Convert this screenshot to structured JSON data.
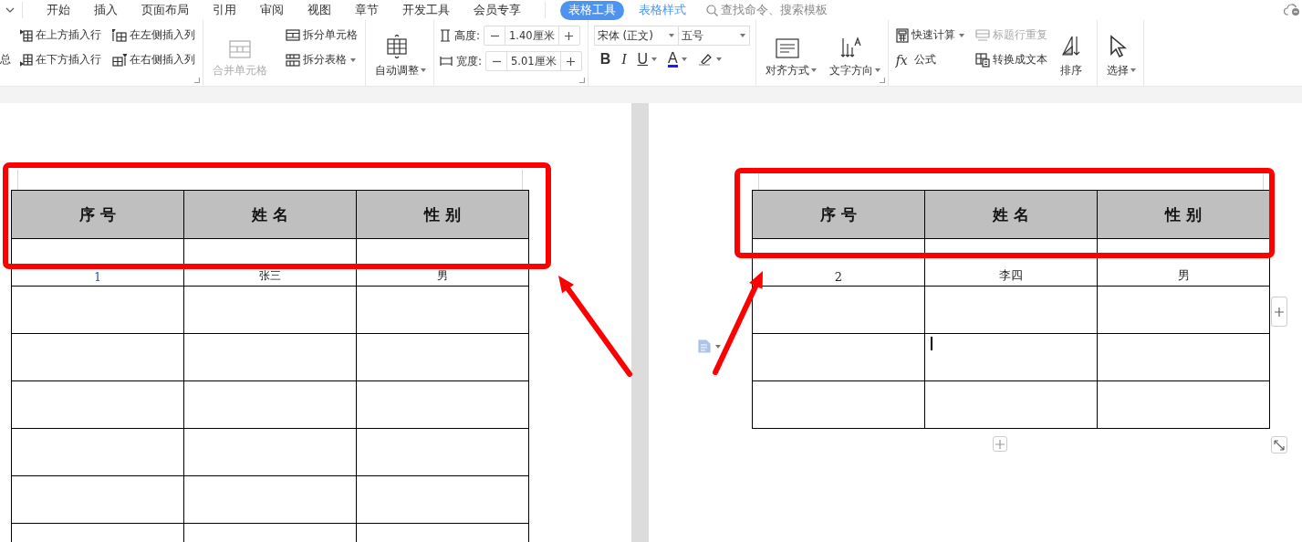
{
  "menu_tabs": [
    {
      "label": "开始",
      "selected": false
    },
    {
      "label": "插入",
      "selected": false
    },
    {
      "label": "页面布局",
      "selected": false
    },
    {
      "label": "引用",
      "selected": false
    },
    {
      "label": "审阅",
      "selected": false
    },
    {
      "label": "视图",
      "selected": false
    },
    {
      "label": "章节",
      "selected": false
    },
    {
      "label": "开发工具",
      "selected": false
    },
    {
      "label": "会员专享",
      "selected": false
    },
    {
      "label": "表格工具",
      "selected": true
    },
    {
      "label": "表格样式",
      "selected": false
    }
  ],
  "search": {
    "placeholder": "查找命令、搜索模板"
  },
  "ribbon": [
    {
      "launcher": true,
      "columns": [
        [
          {
            "kind": "text",
            "label": "总"
          }
        ],
        [
          {
            "kind": "small",
            "label": "在上方插入行",
            "disabled": false,
            "dropdown": false
          },
          {
            "kind": "small",
            "label": "在下方插入行",
            "disabled": false,
            "dropdown": false
          }
        ],
        [
          {
            "kind": "small",
            "label": "在左侧插入列",
            "disabled": false,
            "dropdown": false
          },
          {
            "kind": "small",
            "label": "在右侧插入列",
            "disabled": false,
            "dropdown": false
          }
        ]
      ]
    },
    {
      "columns": [
        [
          {
            "kind": "big",
            "label": "合并单元格",
            "disabled": true,
            "dropdown": false
          }
        ],
        [
          {
            "kind": "small",
            "label": "拆分单元格",
            "disabled": false,
            "dropdown": false
          },
          {
            "kind": "small",
            "label": "拆分表格",
            "disabled": false,
            "dropdown": true
          }
        ]
      ]
    },
    {
      "columns": [
        [
          {
            "kind": "big",
            "label": "自动调整",
            "disabled": false,
            "dropdown": true
          }
        ]
      ]
    },
    {
      "launcher": true,
      "columns": [
        [
          {
            "kind": "stepper",
            "label": "高度:",
            "value": "1.40厘米"
          },
          {
            "kind": "stepper",
            "label": "宽度:",
            "value": "5.01厘米"
          }
        ]
      ]
    },
    {
      "columns": [
        [
          {
            "kind": "fonts",
            "selects": [
              "宋体 (正文)",
              "五号"
            ]
          },
          {
            "kind": "format",
            "buttons": [
              {
                "label": "B",
                "dropdown": false
              },
              {
                "label": "I",
                "dropdown": false
              },
              {
                "label": "U",
                "dropdown": true
              },
              {
                "label": "A",
                "dropdown": true
              }
            ]
          }
        ]
      ]
    },
    {
      "launcher": true,
      "columns": [
        [
          {
            "kind": "big",
            "label": "对齐方式",
            "disabled": false,
            "dropdown": true
          }
        ],
        [
          {
            "kind": "big",
            "label": "文字方向",
            "disabled": false,
            "dropdown": true
          }
        ]
      ]
    },
    {
      "columns": [
        [
          {
            "kind": "small",
            "label": "快速计算",
            "disabled": false,
            "dropdown": true
          },
          {
            "kind": "glyph",
            "glyph": "fx",
            "label": "公式"
          }
        ],
        [
          {
            "kind": "small",
            "label": "标题行重复",
            "disabled": true,
            "dropdown": false
          },
          {
            "kind": "small",
            "label": "转换成文本",
            "disabled": false,
            "dropdown": false
          }
        ],
        [
          {
            "kind": "big",
            "label": "排序",
            "disabled": false,
            "dropdown": false
          }
        ]
      ]
    },
    {
      "columns": [
        [
          {
            "kind": "big",
            "label": "选择",
            "disabled": false,
            "dropdown": true
          }
        ]
      ]
    }
  ],
  "pages": [
    {
      "table": {
        "header": [
          "序 号",
          "姓 名",
          "性 别"
        ],
        "rows": [
          {
            "cells": [
              {
                "text": "1",
                "caret": false
              },
              {
                "text": "张三",
                "caret": false
              },
              {
                "text": "男",
                "caret": false
              }
            ]
          },
          {
            "cells": [
              {
                "caret": false
              },
              {
                "caret": false
              },
              {
                "caret": false
              }
            ]
          },
          {
            "cells": [
              {
                "caret": false
              },
              {
                "caret": false
              },
              {
                "caret": false
              }
            ]
          },
          {
            "cells": [
              {
                "caret": false
              },
              {
                "caret": false
              },
              {
                "caret": false
              }
            ]
          },
          {
            "cells": [
              {
                "caret": false
              },
              {
                "caret": false
              },
              {
                "caret": false
              }
            ]
          },
          {
            "cells": [
              {
                "caret": false
              },
              {
                "caret": false
              },
              {
                "caret": false
              }
            ]
          },
          {
            "cells": [
              {
                "caret": false
              },
              {
                "caret": false
              },
              {
                "caret": false
              }
            ]
          }
        ]
      }
    },
    {
      "table": {
        "header": [
          "序 号",
          "姓 名",
          "性 别"
        ],
        "rows": [
          {
            "cells": [
              {
                "text": "2",
                "caret": false
              },
              {
                "text": "李四",
                "caret": false
              },
              {
                "text": "男",
                "caret": false
              }
            ]
          },
          {
            "cells": [
              {
                "caret": false
              },
              {
                "caret": false
              },
              {
                "caret": false
              }
            ]
          },
          {
            "cells": [
              {
                "caret": false
              },
              {
                "caret": true
              },
              {
                "caret": false
              }
            ]
          },
          {
            "cells": [
              {
                "caret": false
              },
              {
                "caret": false
              },
              {
                "caret": false
              }
            ]
          }
        ]
      }
    }
  ],
  "annotations": [
    {
      "kind": "box"
    },
    {
      "kind": "box"
    },
    {
      "kind": "arrow"
    },
    {
      "kind": "arrow"
    }
  ]
}
